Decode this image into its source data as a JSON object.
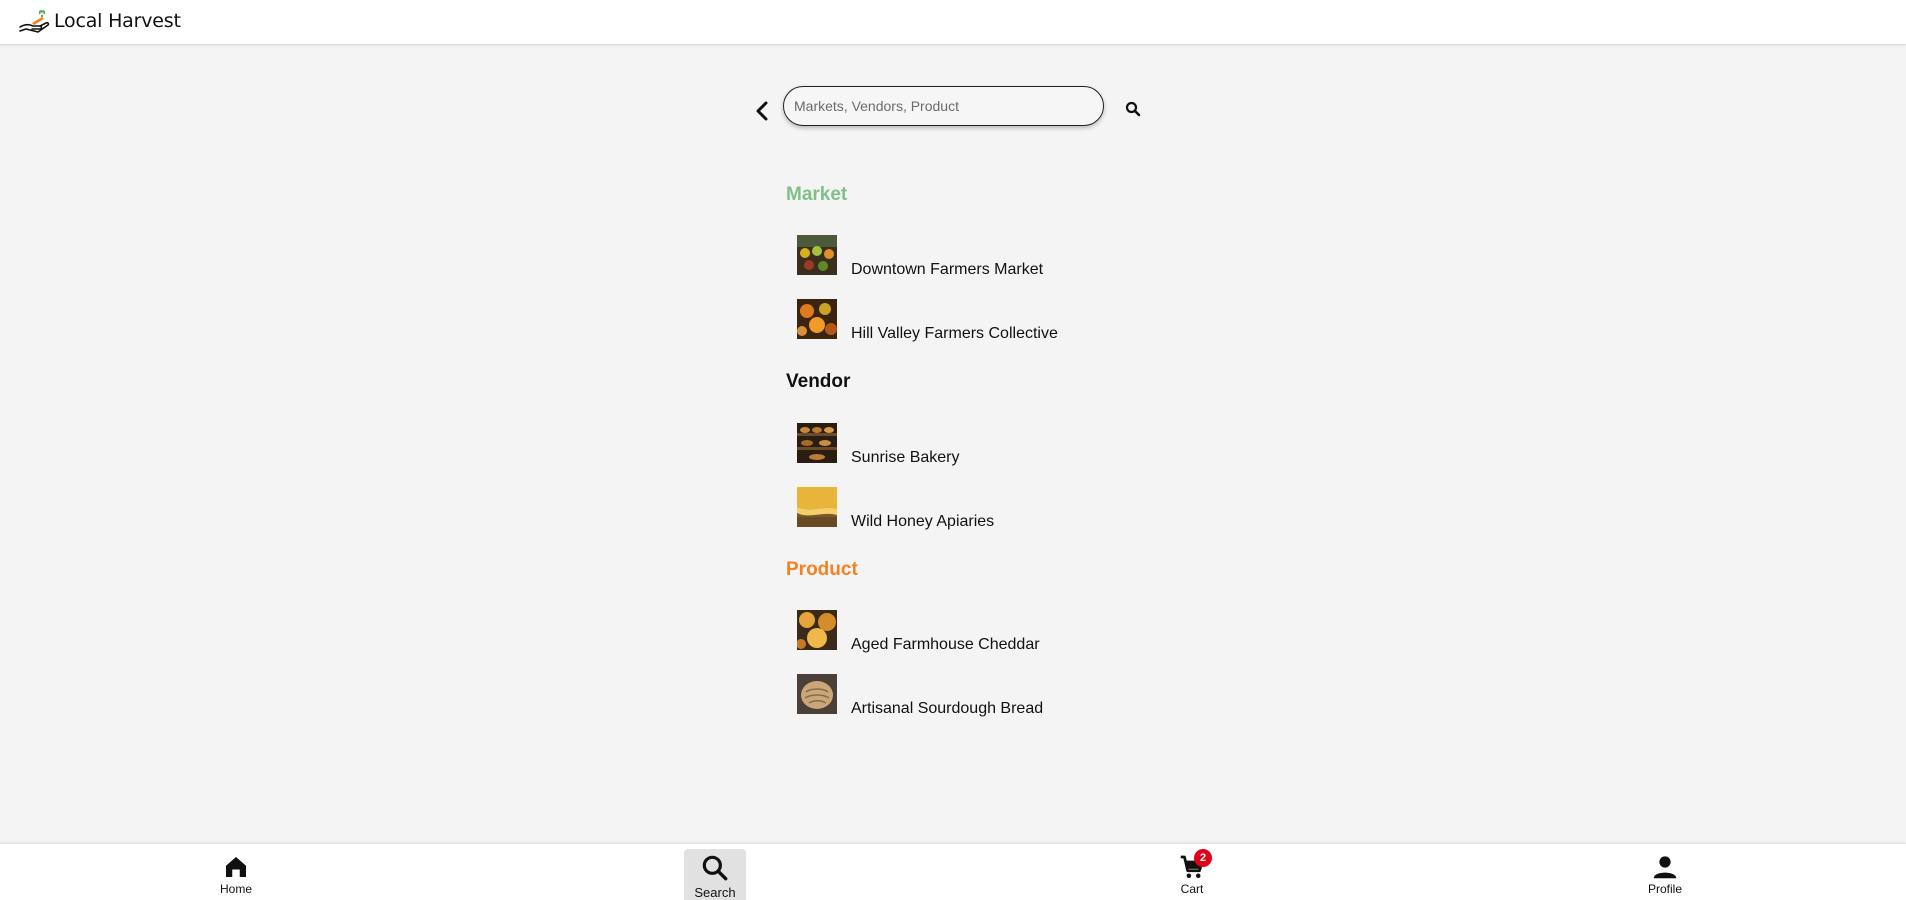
{
  "app": {
    "name": "Local Harvest"
  },
  "search": {
    "placeholder": "Markets, Vendors, Product",
    "value": ""
  },
  "results": {
    "market": {
      "title": "Market",
      "color": "#7fbf8a",
      "items": [
        {
          "label": "Downtown Farmers Market",
          "thumb_icon": "market-produce-photo"
        },
        {
          "label": "Hill Valley Farmers Collective",
          "thumb_icon": "market-pumpkins-photo"
        }
      ]
    },
    "vendor": {
      "title": "Vendor",
      "color": "#111111",
      "items": [
        {
          "label": "Sunrise Bakery",
          "thumb_icon": "bakery-shelves-photo"
        },
        {
          "label": "Wild Honey Apiaries",
          "thumb_icon": "honey-photo"
        }
      ]
    },
    "product": {
      "title": "Product",
      "color": "#f58220",
      "items": [
        {
          "label": "Aged Farmhouse Cheddar",
          "thumb_icon": "cheese-photo"
        },
        {
          "label": "Artisanal Sourdough Bread",
          "thumb_icon": "sourdough-photo"
        }
      ]
    }
  },
  "bottom_nav": {
    "home": {
      "label": "Home",
      "icon": "home-icon"
    },
    "search": {
      "label": "Search",
      "icon": "search-icon",
      "active": true
    },
    "cart": {
      "label": "Cart",
      "icon": "cart-icon",
      "badge": "2"
    },
    "profile": {
      "label": "Profile",
      "icon": "person-icon"
    }
  }
}
